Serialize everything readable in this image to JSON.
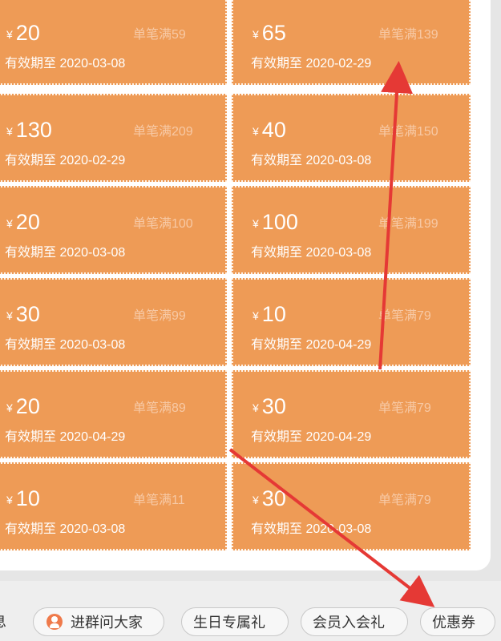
{
  "coupon_label": {
    "yen": "¥"
  },
  "coupons": {
    "left": [
      {
        "amount": "20",
        "condition": "单笔满59",
        "validity": "有效期至 2020-03-08"
      },
      {
        "amount": "130",
        "condition": "单笔满209",
        "validity": "有效期至 2020-02-29"
      },
      {
        "amount": "20",
        "condition": "单笔满100",
        "validity": "有效期至 2020-03-08"
      },
      {
        "amount": "30",
        "condition": "单笔满99",
        "validity": "有效期至 2020-03-08"
      },
      {
        "amount": "20",
        "condition": "单笔满89",
        "validity": "有效期至 2020-04-29"
      },
      {
        "amount": "10",
        "condition": "单笔满11",
        "validity": "有效期至 2020-03-08"
      }
    ],
    "right": [
      {
        "amount": "65",
        "condition": "单笔满139",
        "validity": "有效期至 2020-02-29"
      },
      {
        "amount": "40",
        "condition": "单笔满150",
        "validity": "有效期至 2020-03-08"
      },
      {
        "amount": "100",
        "condition": "单笔满199",
        "validity": "有效期至 2020-03-08"
      },
      {
        "amount": "10",
        "condition": "单笔满79",
        "validity": "有效期至 2020-04-29"
      },
      {
        "amount": "30",
        "condition": "单笔满79",
        "validity": "有效期至 2020-04-29"
      },
      {
        "amount": "30",
        "condition": "单笔满79",
        "validity": "有效期至 2020-03-08"
      }
    ]
  },
  "bottom_bar": {
    "cut_label": "息",
    "group_label": "进群问大家",
    "birthday_label": "生日专属礼",
    "member_label": "会员入会礼",
    "coupon_label": "优惠券"
  },
  "colors": {
    "coupon_background": "#ee9b56",
    "annotation_red": "#e53935"
  },
  "icons": {
    "group": "group-chat-icon",
    "arrows": "red-annotation-arrows"
  }
}
